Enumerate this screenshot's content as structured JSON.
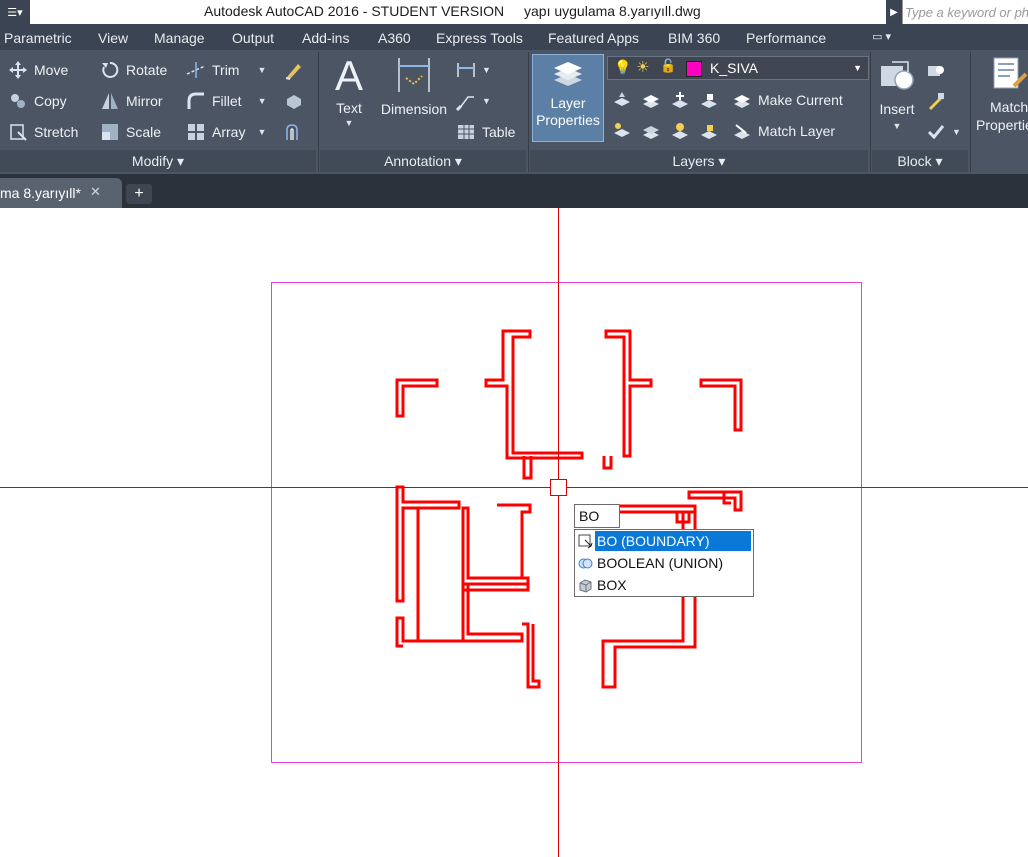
{
  "titlebar": {
    "app_title": "Autodesk AutoCAD 2016 - STUDENT VERSION",
    "file_name": "yapı uygulama 8.yarıyıll.dwg",
    "search_placeholder": "Type a keyword or phrase"
  },
  "menu_tabs": [
    "Parametric",
    "View",
    "Manage",
    "Output",
    "Add-ins",
    "A360",
    "Express Tools",
    "Featured Apps",
    "BIM 360",
    "Performance"
  ],
  "ribbon": {
    "modify": {
      "title": "Modify",
      "buttons": [
        "Move",
        "Rotate",
        "Trim",
        "Copy",
        "Mirror",
        "Fillet",
        "Stretch",
        "Scale",
        "Array"
      ]
    },
    "annotation": {
      "title": "Annotation",
      "text": "Text",
      "dimension": "Dimension",
      "table": "Table"
    },
    "layers": {
      "title": "Layers",
      "layer_properties": [
        "Layer",
        "Properties"
      ],
      "current_layer": "K_SIVA",
      "current_layer_color": "#ff00c0",
      "make_current": "Make Current",
      "match_layer": "Match Layer"
    },
    "block": {
      "title": "Block",
      "insert": "Insert"
    },
    "properties": {
      "match_properties": [
        "Match",
        "Properties"
      ]
    }
  },
  "document_tab": {
    "label": "ma 8.yarıyıll*",
    "close_symbol": "✕",
    "new_tab_symbol": "+"
  },
  "command": {
    "typed": "BO",
    "suggestions": [
      {
        "label": "BO (BOUNDARY)",
        "icon": "boundary-icon",
        "selected": true
      },
      {
        "label": "BOOLEAN (UNION)",
        "icon": "boolean-union-icon",
        "selected": false
      },
      {
        "label": "BOX",
        "icon": "box-icon",
        "selected": false
      }
    ]
  },
  "colors": {
    "ribbon_bg": "#4b5563",
    "menubar_bg": "#3b4452",
    "plan_lines": "#ff0000",
    "viewport_frame": "#e040e0",
    "crosshair": "#dd0000",
    "selection_highlight": "#0a78d7"
  }
}
